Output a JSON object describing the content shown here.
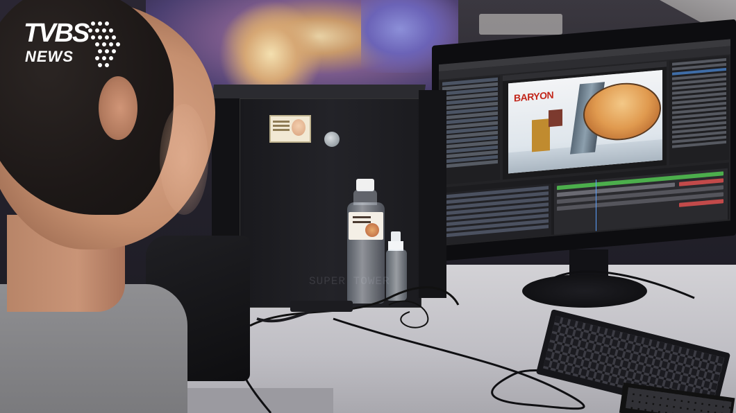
{
  "logo": {
    "brand": "TVBS",
    "sub": "NEWS"
  },
  "viewer": {
    "title_art": "BARYON"
  },
  "tower": {
    "brand_text": "SUPER TOWER"
  },
  "colors": {
    "logo_text": "#ffffff",
    "baryon_red": "#c2261a",
    "timeline_accent": "#5aa0ff",
    "track_green": "#4cae4c",
    "track_red": "#c24a4a"
  }
}
